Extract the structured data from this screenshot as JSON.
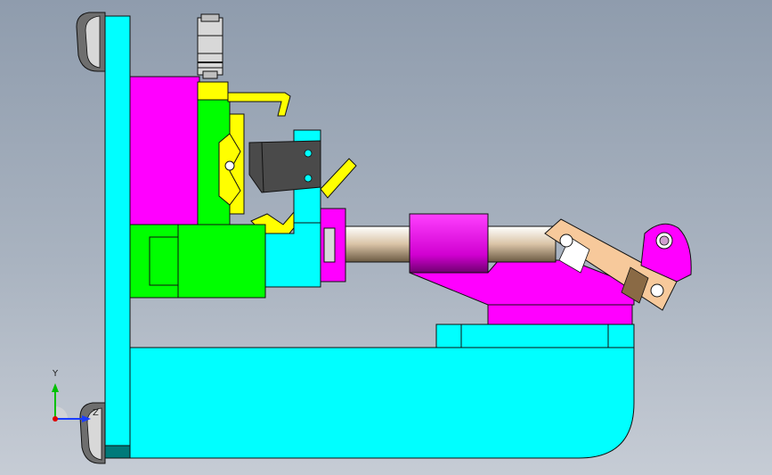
{
  "viewport": {
    "background_top": "#8f9cad",
    "background_bottom": "#c6ccd5"
  },
  "colors": {
    "cyan": "#00ffff",
    "magenta": "#ff00ff",
    "green": "#00ff00",
    "yellow": "#ffff00",
    "dark_gray": "#4a4a4a",
    "tan": "#f7c99b",
    "brown": "#8a6a45"
  },
  "triad": {
    "y_label": "Y",
    "z_label": "Z",
    "y_color": "#00c000",
    "z_color": "#1a3cff",
    "origin_color": "#e00000"
  }
}
